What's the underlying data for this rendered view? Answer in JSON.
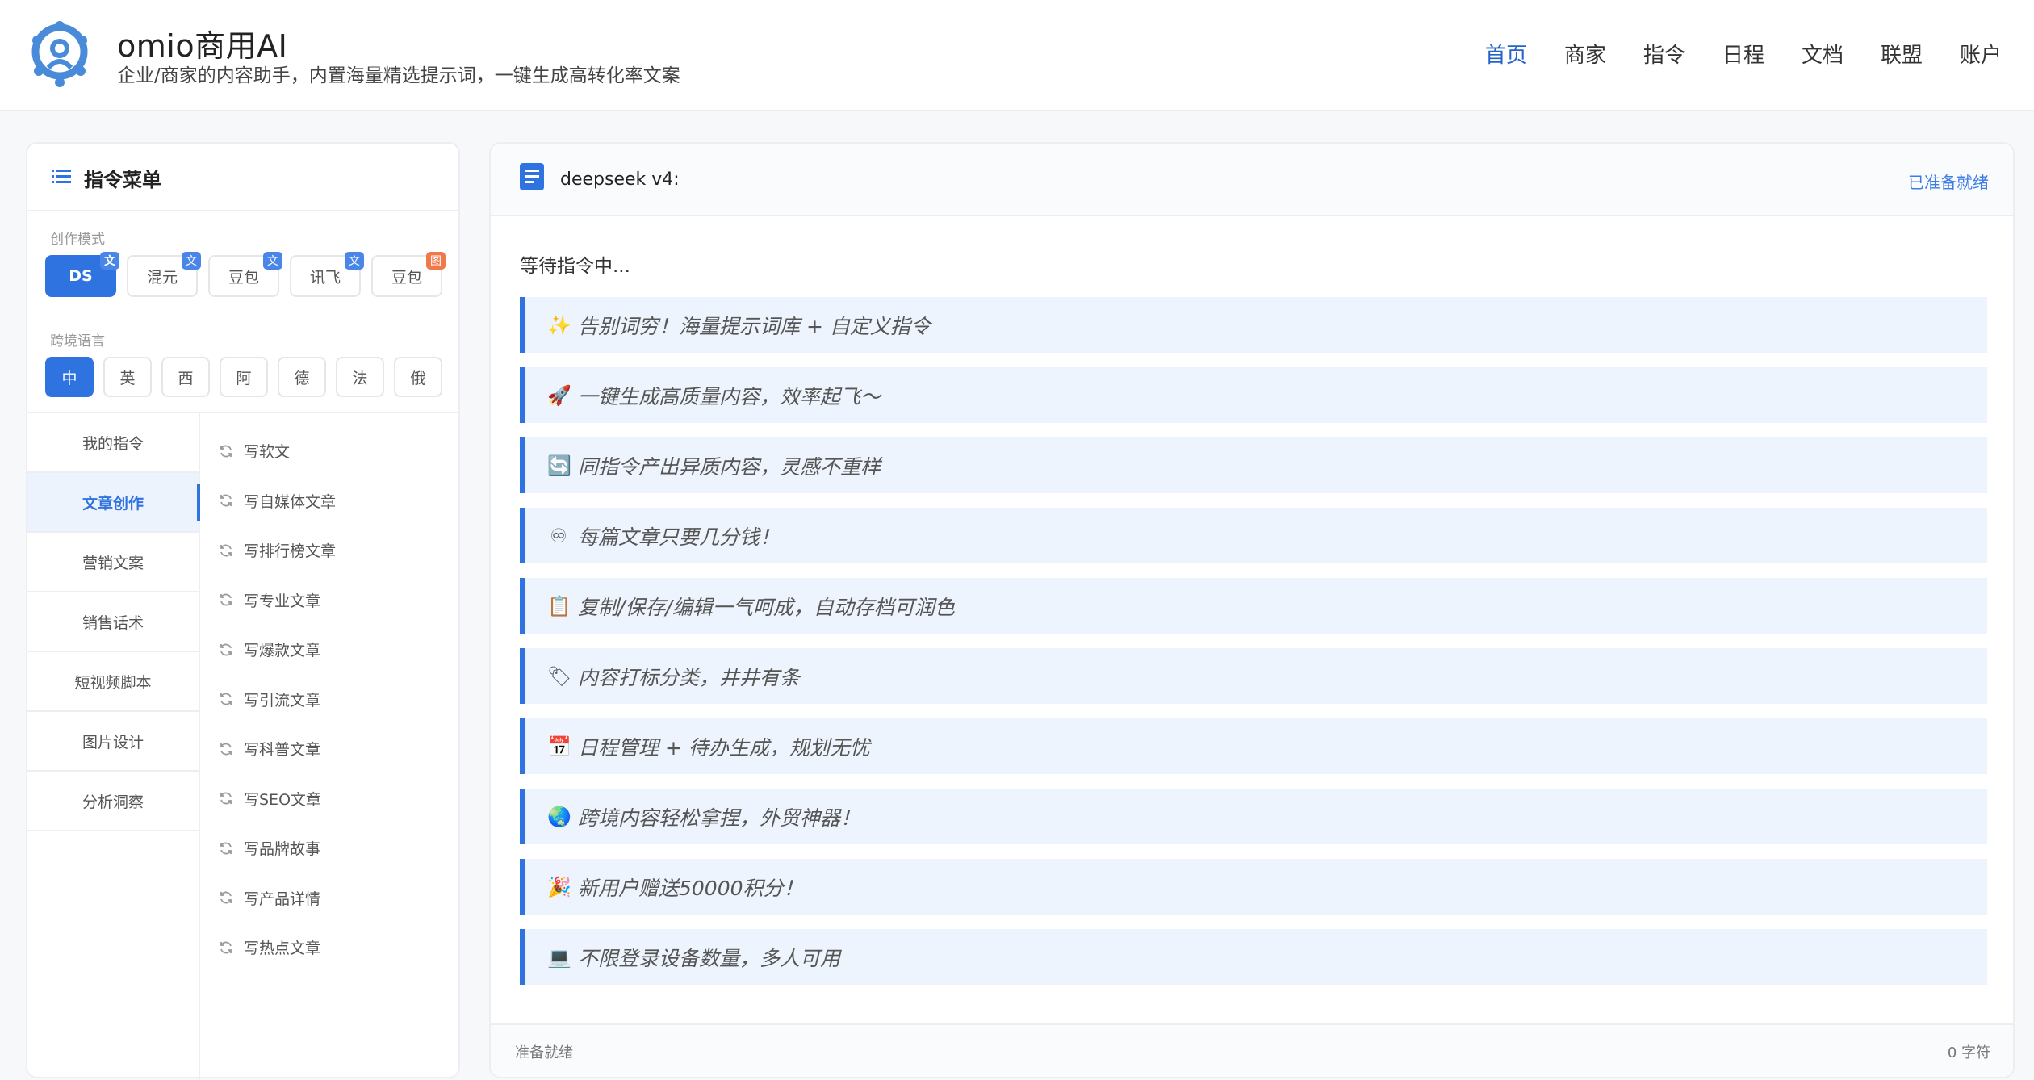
{
  "header": {
    "title": "omio商用AI",
    "subtitle": "企业/商家的内容助手，内置海量精选提示词，一键生成高转化率文案",
    "nav": [
      "首页",
      "商家",
      "指令",
      "日程",
      "文档",
      "联盟",
      "账户"
    ],
    "active_nav": "首页"
  },
  "sidebar": {
    "title": "指令菜单",
    "mode_label": "创作模式",
    "modes": [
      {
        "label": "DS",
        "badge": "文",
        "active": true
      },
      {
        "label": "混元",
        "badge": "文"
      },
      {
        "label": "豆包",
        "badge": "文"
      },
      {
        "label": "讯飞",
        "badge": "文"
      },
      {
        "label": "豆包",
        "badge": "图"
      }
    ],
    "lang_label": "跨境语言",
    "langs": [
      "中",
      "英",
      "西",
      "阿",
      "德",
      "法",
      "俄"
    ],
    "active_lang": "中",
    "categories": [
      "我的指令",
      "文章创作",
      "营销文案",
      "销售话术",
      "短视频脚本",
      "图片设计",
      "分析洞察"
    ],
    "active_category": "文章创作",
    "commands": [
      "写软文",
      "写自媒体文章",
      "写排行榜文章",
      "写专业文章",
      "写爆款文章",
      "写引流文章",
      "写科普文章",
      "写SEO文章",
      "写品牌故事",
      "写产品详情",
      "写热点文章"
    ]
  },
  "main": {
    "model": "deepseek v4:",
    "status": "已准备就绪",
    "waiting": "等待指令中...",
    "features": [
      {
        "emoji": "✨",
        "text": "告别词穷！海量提示词库 + 自定义指令"
      },
      {
        "emoji": "🚀",
        "text": "一键生成高质量内容，效率起飞～"
      },
      {
        "emoji": "🔄",
        "text": "同指令产出异质内容，灵感不重样"
      },
      {
        "emoji": "♾",
        "text": "每篇文章只要几分钱！"
      },
      {
        "emoji": "📋",
        "text": "复制/保存/编辑一气呵成，自动存档可润色"
      },
      {
        "emoji": "🏷",
        "text": "内容打标分类，井井有条"
      },
      {
        "emoji": "📅",
        "text": "日程管理 + 待办生成，规划无忧"
      },
      {
        "emoji": "🌏",
        "text": "跨境内容轻松拿捏，外贸神器！"
      },
      {
        "emoji": "🎉",
        "text": "新用户赠送50000积分！"
      },
      {
        "emoji": "💻",
        "text": "不限登录设备数量，多人可用"
      }
    ],
    "footer_status": "准备就绪",
    "char_count": "0 字符"
  },
  "colors": {
    "accent": "#2f73e0",
    "badge_text": "#4a86e8",
    "badge_image": "#f0784a",
    "feature_bg": "#eef4fd"
  }
}
